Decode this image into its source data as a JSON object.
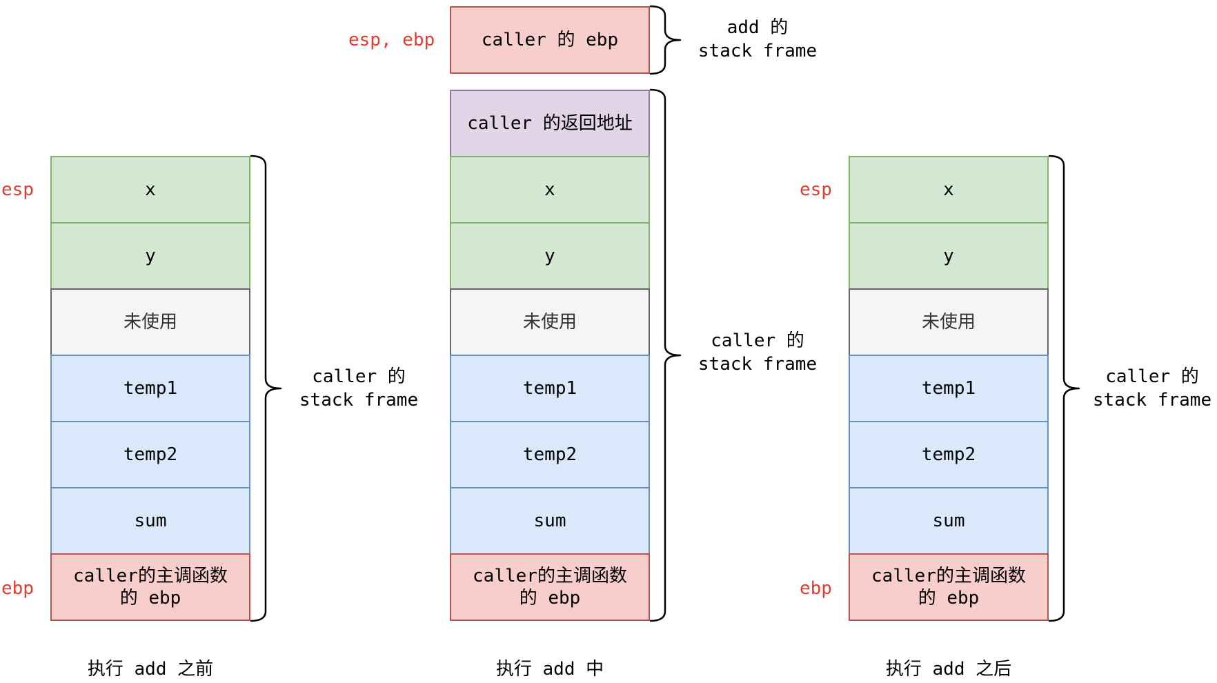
{
  "register_label_color": "#E53B2F",
  "before": {
    "caption": "执行 add 之前",
    "esp_label": "esp",
    "ebp_label": "ebp",
    "frame_label": {
      "line1": "caller 的",
      "line2": "stack frame"
    },
    "cells": [
      {
        "fill": "#d5e8d4",
        "stroke": "#82b366",
        "lines": [
          "x"
        ]
      },
      {
        "fill": "#d5e8d4",
        "stroke": "#82b366",
        "lines": [
          "y"
        ]
      },
      {
        "fill": "#f5f5f5",
        "stroke": "#666666",
        "text_color": "#333333",
        "lines": [
          "未使用"
        ]
      },
      {
        "fill": "#dae8fc",
        "stroke": "#6c8ebf",
        "lines": [
          "temp1"
        ]
      },
      {
        "fill": "#dae8fc",
        "stroke": "#6c8ebf",
        "lines": [
          "temp2"
        ]
      },
      {
        "fill": "#dae8fc",
        "stroke": "#6c8ebf",
        "lines": [
          "sum"
        ]
      },
      {
        "fill": "#f8cecc",
        "stroke": "#b85450",
        "lines": [
          "caller的主调函数",
          "的 ebp"
        ]
      }
    ]
  },
  "during": {
    "caption": "执行 add 中",
    "esp_ebp_label": "esp, ebp",
    "add_frame": {
      "label": {
        "line1": "add 的",
        "line2": "stack frame"
      },
      "cells": [
        {
          "fill": "#f8cecc",
          "stroke": "#b85450",
          "lines": [
            "caller 的 ebp"
          ]
        }
      ]
    },
    "frame_label": {
      "line1": "caller 的",
      "line2": "stack frame"
    },
    "cells": [
      {
        "fill": "#e1d5e7",
        "stroke": "#9673a6",
        "lines": [
          "caller 的返回地址"
        ]
      },
      {
        "fill": "#d5e8d4",
        "stroke": "#82b366",
        "lines": [
          "x"
        ]
      },
      {
        "fill": "#d5e8d4",
        "stroke": "#82b366",
        "lines": [
          "y"
        ]
      },
      {
        "fill": "#f5f5f5",
        "stroke": "#666666",
        "text_color": "#333333",
        "lines": [
          "未使用"
        ]
      },
      {
        "fill": "#dae8fc",
        "stroke": "#6c8ebf",
        "lines": [
          "temp1"
        ]
      },
      {
        "fill": "#dae8fc",
        "stroke": "#6c8ebf",
        "lines": [
          "temp2"
        ]
      },
      {
        "fill": "#dae8fc",
        "stroke": "#6c8ebf",
        "lines": [
          "sum"
        ]
      },
      {
        "fill": "#f8cecc",
        "stroke": "#b85450",
        "lines": [
          "caller的主调函数",
          "的 ebp"
        ]
      }
    ]
  },
  "after": {
    "caption": "执行 add 之后",
    "esp_label": "esp",
    "ebp_label": "ebp",
    "frame_label": {
      "line1": "caller 的",
      "line2": "stack frame"
    },
    "cells": [
      {
        "fill": "#d5e8d4",
        "stroke": "#82b366",
        "lines": [
          "x"
        ]
      },
      {
        "fill": "#d5e8d4",
        "stroke": "#82b366",
        "lines": [
          "y"
        ]
      },
      {
        "fill": "#f5f5f5",
        "stroke": "#666666",
        "text_color": "#333333",
        "lines": [
          "未使用"
        ]
      },
      {
        "fill": "#dae8fc",
        "stroke": "#6c8ebf",
        "lines": [
          "temp1"
        ]
      },
      {
        "fill": "#dae8fc",
        "stroke": "#6c8ebf",
        "lines": [
          "temp2"
        ]
      },
      {
        "fill": "#dae8fc",
        "stroke": "#6c8ebf",
        "lines": [
          "sum"
        ]
      },
      {
        "fill": "#f8cecc",
        "stroke": "#b85450",
        "lines": [
          "caller的主调函数",
          "的 ebp"
        ]
      }
    ]
  }
}
